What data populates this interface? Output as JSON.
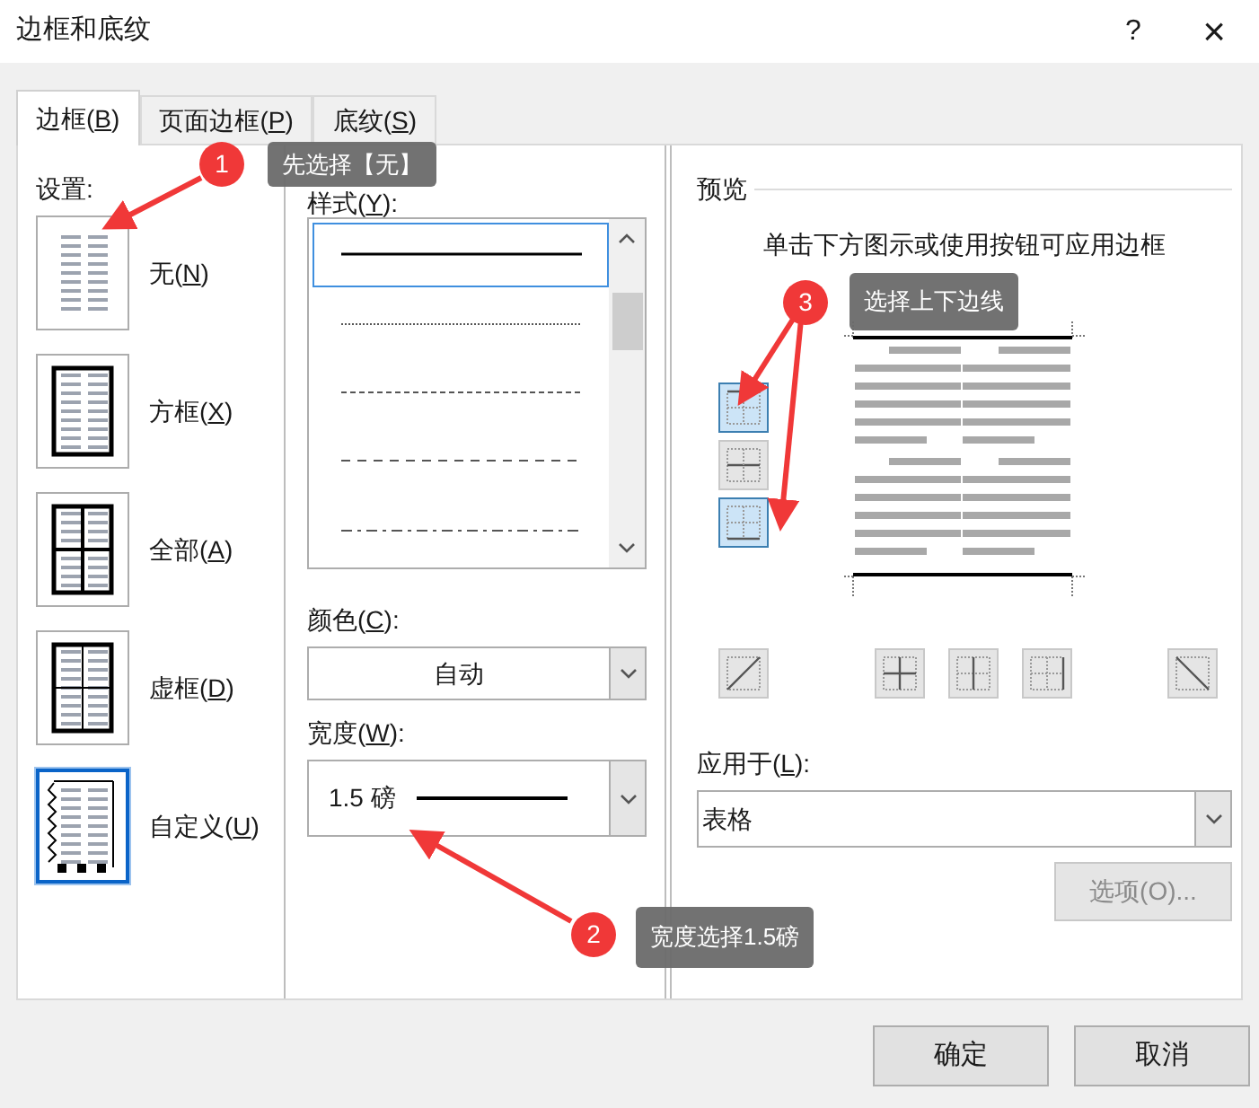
{
  "window": {
    "title": "边框和底纹",
    "help": "?",
    "close": "×"
  },
  "tabs": [
    {
      "label": "边框(B)",
      "selected": true
    },
    {
      "label": "页面边框(P)",
      "selected": false
    },
    {
      "label": "底纹(S)",
      "selected": false
    }
  ],
  "settings": {
    "label": "设置:",
    "items": [
      {
        "label": "无(N)",
        "kind": "none",
        "selected": false
      },
      {
        "label": "方框(X)",
        "kind": "box",
        "selected": false
      },
      {
        "label": "全部(A)",
        "kind": "all",
        "selected": false
      },
      {
        "label": "虚框(D)",
        "kind": "grid",
        "selected": false
      },
      {
        "label": "自定义(U)",
        "kind": "custom",
        "selected": true
      }
    ]
  },
  "style": {
    "label": "样式(Y):",
    "lines": [
      {
        "kind": "solid",
        "selected": true
      },
      {
        "kind": "dotted",
        "selected": false
      },
      {
        "kind": "fine-dash",
        "selected": false
      },
      {
        "kind": "dash",
        "selected": false
      },
      {
        "kind": "dash-dot",
        "selected": false
      }
    ]
  },
  "color": {
    "label": "颜色(C):",
    "value": "自动"
  },
  "width": {
    "label": "宽度(W):",
    "value": "1.5 磅"
  },
  "preview": {
    "label": "预览",
    "hint": "单击下方图示或使用按钮可应用边框",
    "side_buttons": [
      {
        "kind": "top",
        "selected": true
      },
      {
        "kind": "middle",
        "selected": false
      },
      {
        "kind": "bottom",
        "selected": true
      }
    ],
    "bottom_buttons": [
      {
        "kind": "diag-up"
      },
      {
        "kind": "inside-both"
      },
      {
        "kind": "inside-v"
      },
      {
        "kind": "right"
      },
      {
        "kind": "diag-down"
      }
    ]
  },
  "apply": {
    "label": "应用于(L):",
    "value": "表格"
  },
  "options_button": {
    "label": "选项(O)...",
    "disabled": true
  },
  "buttons": [
    "确定",
    "取消"
  ],
  "annotations": [
    {
      "number": "1",
      "text": "先选择【无】"
    },
    {
      "number": "2",
      "text": "宽度选择1.5磅"
    },
    {
      "number": "3",
      "text": "选择上下边线"
    }
  ]
}
